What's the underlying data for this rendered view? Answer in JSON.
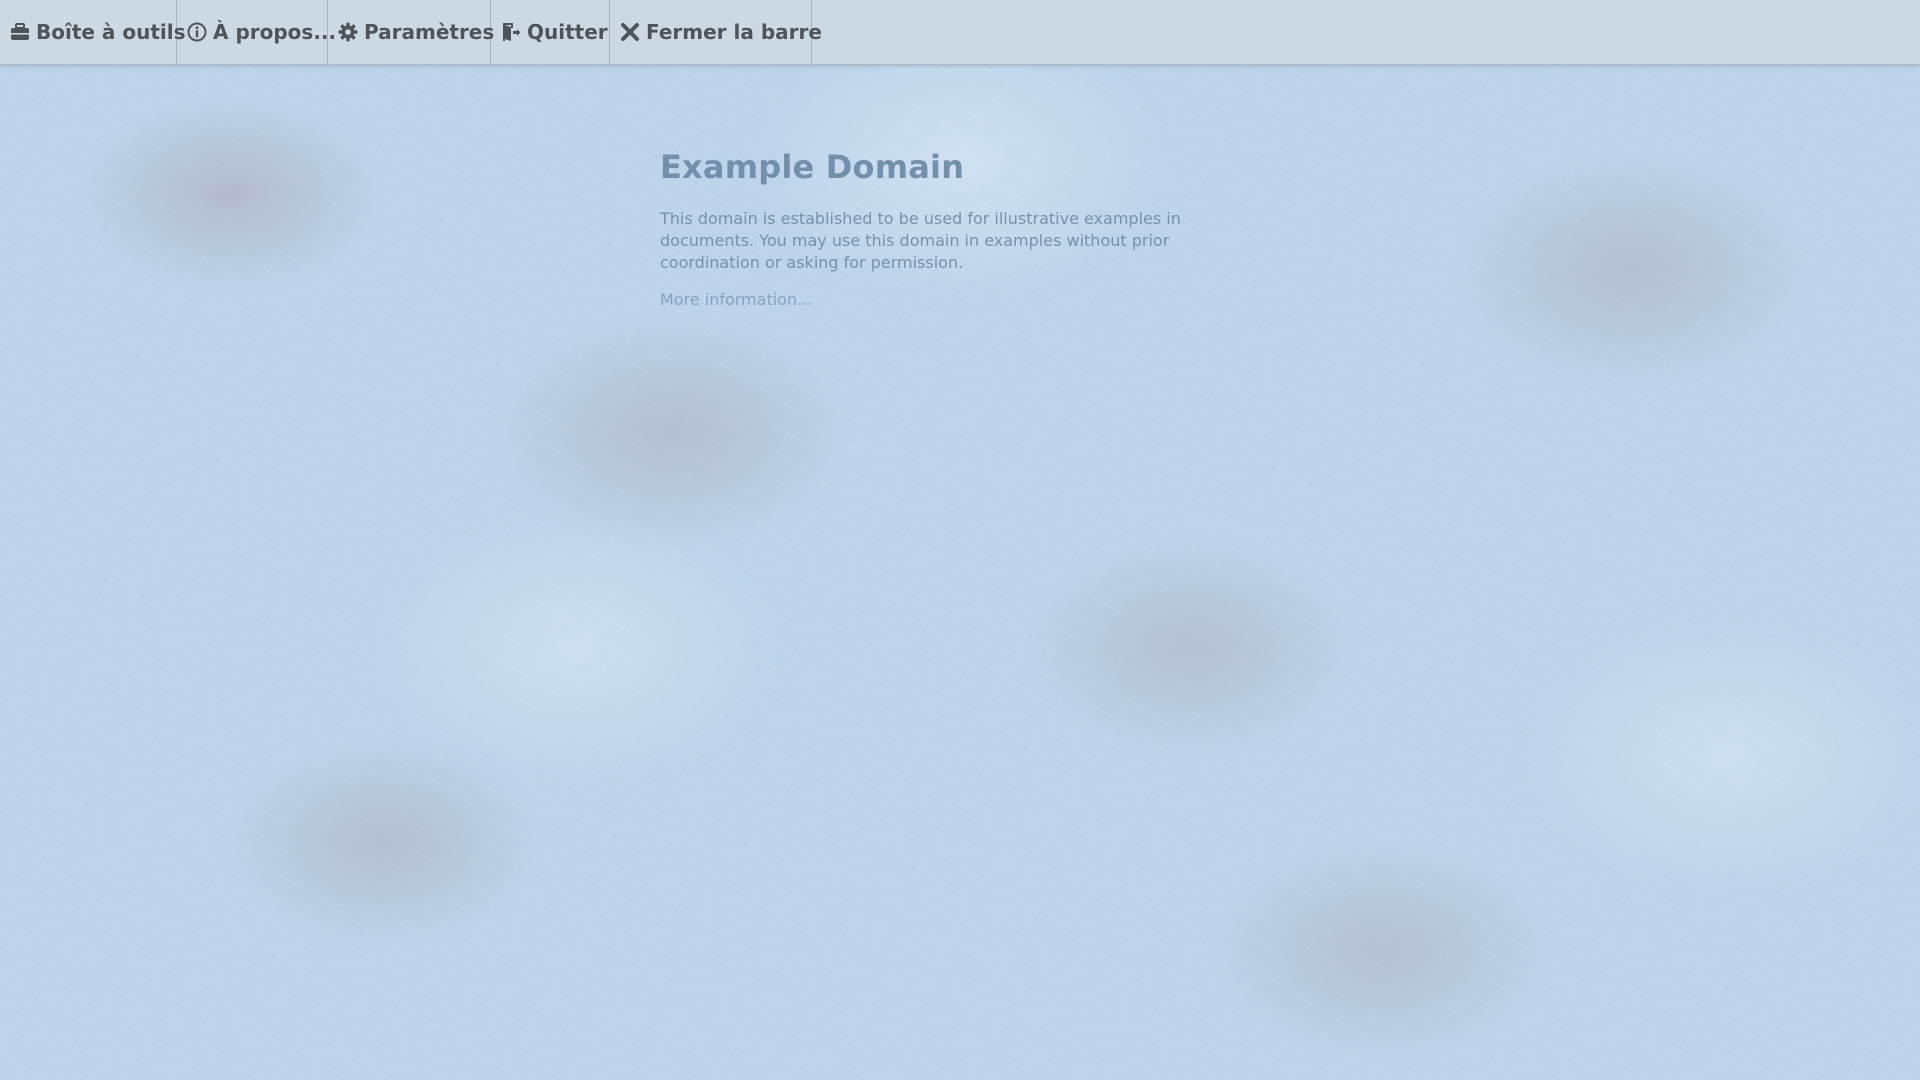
{
  "toolbar": {
    "items": [
      {
        "label": "Boîte à outils",
        "icon": "toolbox-icon"
      },
      {
        "label": "À propos...",
        "icon": "info-icon"
      },
      {
        "label": "Paramètres",
        "icon": "gear-icon"
      },
      {
        "label": "Quitter",
        "icon": "exit-door-icon"
      },
      {
        "label": "Fermer la barre",
        "icon": "close-icon"
      }
    ]
  },
  "page": {
    "title": "Example Domain",
    "paragraph": "This domain is established to be used for illustrative examples in documents. You may use this domain in examples without prior coordination or asking for permission.",
    "link_text": "More information..."
  },
  "colors": {
    "toolbar_text": "#4f5459",
    "heading": "#7290ab",
    "body_text": "#7791a9",
    "link": "#86a3bd"
  }
}
